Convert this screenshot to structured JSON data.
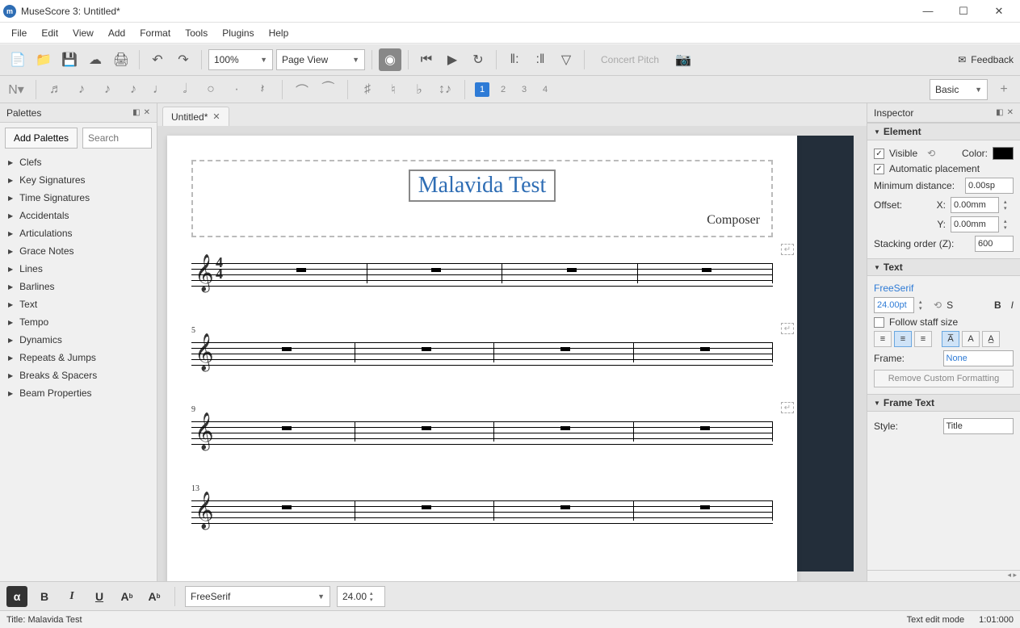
{
  "window": {
    "title": "MuseScore 3: Untitled*"
  },
  "menubar": [
    "File",
    "Edit",
    "View",
    "Add",
    "Format",
    "Tools",
    "Plugins",
    "Help"
  ],
  "toolbar": {
    "zoom": "100%",
    "viewmode": "Page View",
    "concert_pitch": "Concert Pitch",
    "feedback": "Feedback",
    "workspace": "Basic"
  },
  "voices": [
    "1",
    "2",
    "3",
    "4"
  ],
  "tab": {
    "label": "Untitled*"
  },
  "palettes": {
    "title": "Palettes",
    "add_btn": "Add Palettes",
    "search_ph": "Search",
    "items": [
      "Clefs",
      "Key Signatures",
      "Time Signatures",
      "Accidentals",
      "Articulations",
      "Grace Notes",
      "Lines",
      "Barlines",
      "Text",
      "Tempo",
      "Dynamics",
      "Repeats & Jumps",
      "Breaks & Spacers",
      "Beam Properties"
    ]
  },
  "score": {
    "title": "Malavida Test",
    "composer": "Composer",
    "measure_nums": [
      "5",
      "9",
      "13"
    ]
  },
  "inspector": {
    "title": "Inspector",
    "element": {
      "hdr": "Element",
      "visible": "Visible",
      "color_lbl": "Color:",
      "autoplace": "Automatic placement",
      "mindist_lbl": "Minimum distance:",
      "mindist": "0.00sp",
      "offset_lbl": "Offset:",
      "x_lbl": "X:",
      "x": "0.00mm",
      "y_lbl": "Y:",
      "y": "0.00mm",
      "stack_lbl": "Stacking order (Z):",
      "stack": "600"
    },
    "text": {
      "hdr": "Text",
      "font": "FreeSerif",
      "size": "24.00pt",
      "follow": "Follow staff size",
      "frame_lbl": "Frame:",
      "frame": "None",
      "remove": "Remove Custom Formatting",
      "s_label": "S",
      "bold": "B",
      "italic": "I"
    },
    "frametext": {
      "hdr": "Frame Text",
      "style_lbl": "Style:",
      "style": "Title"
    }
  },
  "bottom": {
    "font": "FreeSerif",
    "size": "24.00"
  },
  "status": {
    "left": "Title: Malavida Test",
    "mode": "Text edit mode",
    "pos": "1:01:000"
  }
}
